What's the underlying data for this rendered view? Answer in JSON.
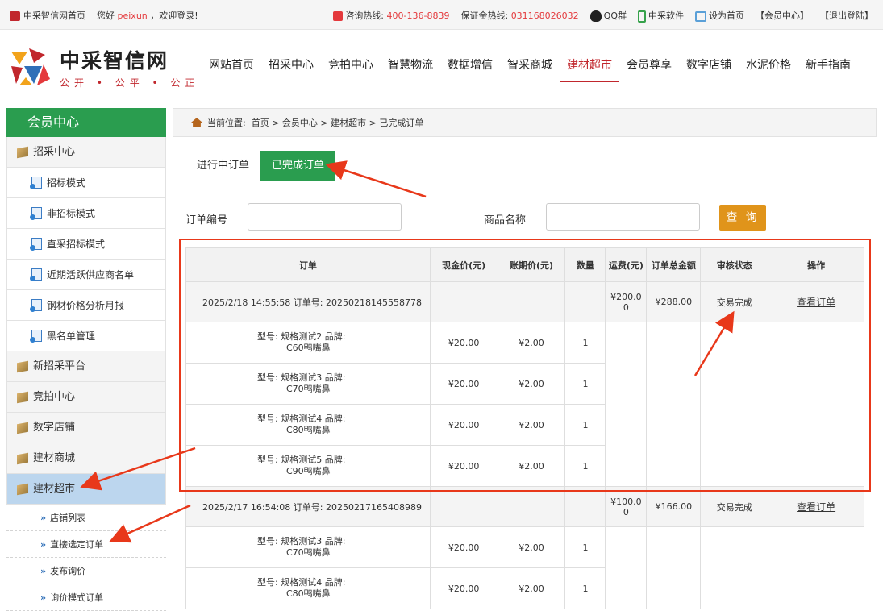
{
  "topbar": {
    "home_link": "中采智信网首页",
    "greeting_prefix": "您好",
    "username": "peixun",
    "greeting_suffix": "，欢迎登录!",
    "hotline_label": "咨询热线:",
    "hotline": "400-136-8839",
    "deposit_label": "保证金热线:",
    "deposit_phone": "031168026032",
    "qq": "QQ群",
    "software": "中采软件",
    "set_home": "设为首页",
    "member_center": "【会员中心】",
    "logout": "【退出登陆】"
  },
  "logo": {
    "title": "中采智信网",
    "slogan": "公开 • 公平 • 公正"
  },
  "nav": {
    "items": [
      "网站首页",
      "招采中心",
      "竞拍中心",
      "智慧物流",
      "数据增信",
      "智采商城",
      "建材超市",
      "会员尊享",
      "数字店铺",
      "水泥价格",
      "新手指南"
    ],
    "active_index": 6
  },
  "sidebar": {
    "title": "会员中心",
    "cat_zhaocai": "招采中心",
    "subs": [
      "招标模式",
      "非招标模式",
      "直采招标模式",
      "近期活跃供应商名单",
      "钢材价格分析月报",
      "黑名单管理"
    ],
    "cat_xinzhaocai": "新招采平台",
    "cat_jingpai": "竞拍中心",
    "cat_shuzi": "数字店铺",
    "cat_jiancai_mall": "建材商城",
    "cat_jiancai_market": "建材超市",
    "subs2": [
      "店铺列表",
      "直接选定订单",
      "发布询价",
      "询价模式订单"
    ]
  },
  "breadcrumb": {
    "label": "当前位置:",
    "path": "首页 > 会员中心 > 建材超市 > 已完成订单"
  },
  "tabs": {
    "ongoing": "进行中订单",
    "completed": "已完成订单"
  },
  "filters": {
    "order_no_label": "订单编号",
    "product_label": "商品名称",
    "query_button": "查 询"
  },
  "table": {
    "headers": [
      "订单",
      "现金价(元)",
      "账期价(元)",
      "数量",
      "运费(元)",
      "订单总金额",
      "审核状态",
      "操作"
    ]
  },
  "orders": [
    {
      "info": "2025/2/18 14:55:58    订单号: 20250218145558778",
      "freight_line1": "¥200.0",
      "freight_line2": "0",
      "total": "¥288.00",
      "status": "交易完成",
      "action": "查看订单",
      "items": [
        {
          "spec1": "型号: 规格测试2   品牌:",
          "spec2": "C60鸭嘴鼻",
          "cash": "¥20.00",
          "credit": "¥2.00",
          "qty": "1"
        },
        {
          "spec1": "型号: 规格测试3   品牌:",
          "spec2": "C70鸭嘴鼻",
          "cash": "¥20.00",
          "credit": "¥2.00",
          "qty": "1"
        },
        {
          "spec1": "型号: 规格测试4   品牌:",
          "spec2": "C80鸭嘴鼻",
          "cash": "¥20.00",
          "credit": "¥2.00",
          "qty": "1"
        },
        {
          "spec1": "型号: 规格测试5   品牌:",
          "spec2": "C90鸭嘴鼻",
          "cash": "¥20.00",
          "credit": "¥2.00",
          "qty": "1"
        }
      ]
    },
    {
      "info": "2025/2/17 16:54:08    订单号: 20250217165408989",
      "freight_line1": "¥100.0",
      "freight_line2": "0",
      "total": "¥166.00",
      "status": "交易完成",
      "action": "查看订单",
      "items": [
        {
          "spec1": "型号: 规格测试3   品牌:",
          "spec2": "C70鸭嘴鼻",
          "cash": "¥20.00",
          "credit": "¥2.00",
          "qty": "1"
        },
        {
          "spec1": "型号: 规格测试4   品牌:",
          "spec2": "C80鸭嘴鼻",
          "cash": "¥20.00",
          "credit": "¥2.00",
          "qty": "1"
        }
      ]
    }
  ],
  "colors": {
    "brand_green": "#2a9d4f",
    "brand_red": "#c1272d",
    "highlight_red": "#e8381a",
    "button_orange": "#e0941a",
    "sidebar_active": "#bcd6ee"
  }
}
